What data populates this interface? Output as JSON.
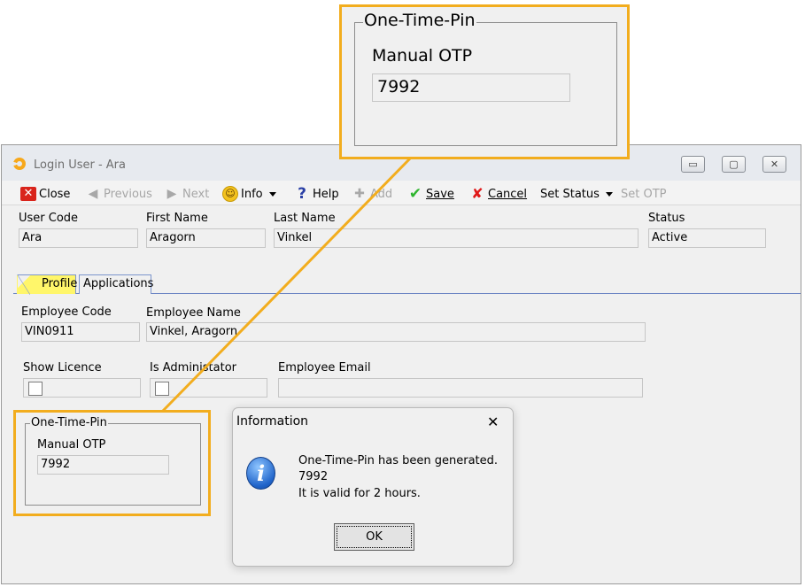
{
  "window": {
    "title": "Login User - Ara",
    "caption_buttons": {
      "minimize": "▭",
      "maximize": "▢",
      "close": "✕"
    }
  },
  "toolbar": {
    "close": "Close",
    "previous": "Previous",
    "next": "Next",
    "info": "Info",
    "help": "Help",
    "add": "Add",
    "save": "Save",
    "cancel": "Cancel",
    "set_status": "Set Status",
    "set_otp": "Set OTP"
  },
  "header": {
    "user_code": {
      "label": "User Code",
      "value": "Ara"
    },
    "first_name": {
      "label": "First Name",
      "value": "Aragorn"
    },
    "last_name": {
      "label": "Last Name",
      "value": "Vinkel"
    },
    "status": {
      "label": "Status",
      "value": "Active"
    }
  },
  "tabs": [
    {
      "label": "Profile",
      "active": true
    },
    {
      "label": "Applications",
      "active": false
    }
  ],
  "profile": {
    "employee_code": {
      "label": "Employee Code",
      "value": "VIN0911"
    },
    "employee_name": {
      "label": "Employee Name",
      "value": "Vinkel, Aragorn"
    },
    "show_licence": {
      "label": "Show Licence",
      "checked": false
    },
    "is_administrator": {
      "label": "Is Administator",
      "checked": false
    },
    "employee_email": {
      "label": "Employee Email",
      "value": ""
    }
  },
  "otp_group": {
    "title": "One-Time-Pin",
    "manual_otp_label": "Manual OTP",
    "manual_otp_value": "7992"
  },
  "callout": {
    "title": "One-Time-Pin",
    "manual_otp_label": "Manual OTP",
    "manual_otp_value": "7992"
  },
  "dialog": {
    "title": "Information",
    "close": "✕",
    "message_line1": "One-Time-Pin has been generated.",
    "message_line2": "7992",
    "message_line3": "It is valid for 2 hours.",
    "ok": "OK"
  },
  "colors": {
    "highlight": "#f2ad1e",
    "active_tab": "#fff66a",
    "window_bg": "#f0f0f0"
  }
}
